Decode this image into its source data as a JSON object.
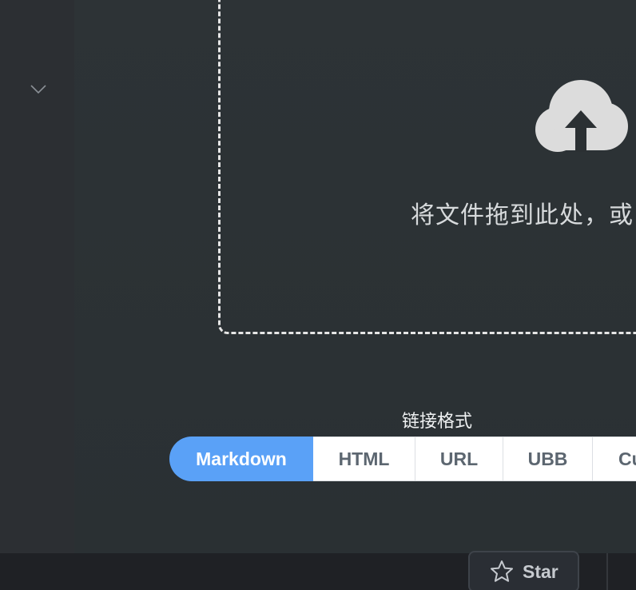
{
  "sidebar": {
    "collapse_icon": "chevron-down-icon"
  },
  "upload": {
    "icon": "cloud-upload-icon",
    "hint_text": "将文件拖到此处，或"
  },
  "link_format": {
    "label": "链接格式",
    "tabs": [
      {
        "label": "Markdown",
        "active": true
      },
      {
        "label": "HTML",
        "active": false
      },
      {
        "label": "URL",
        "active": false
      },
      {
        "label": "UBB",
        "active": false
      },
      {
        "label": "Cu",
        "active": false
      }
    ]
  },
  "footer": {
    "star_label": "Star",
    "star_icon": "star-icon"
  },
  "colors": {
    "accent": "#5aa1f7",
    "background": "#2b3033",
    "footer": "#1f2125"
  }
}
